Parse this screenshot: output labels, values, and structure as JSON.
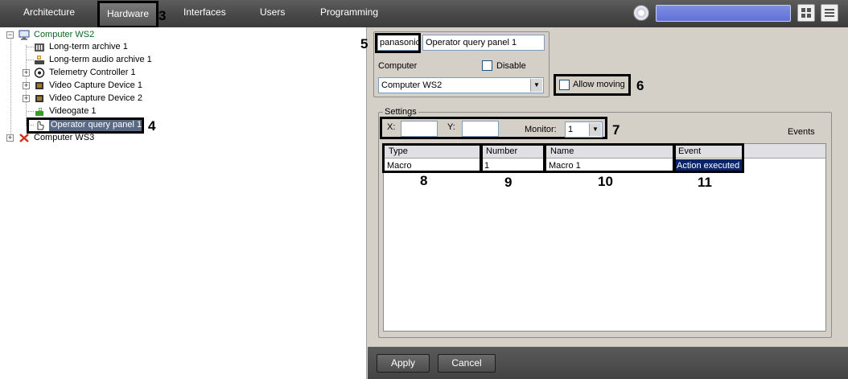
{
  "nav": {
    "tabs": [
      "Architecture",
      "Hardware",
      "Interfaces",
      "Users",
      "Programming"
    ],
    "active_tab": "Hardware",
    "search_value": ""
  },
  "tree": {
    "items": [
      {
        "label": "Computer WS2",
        "icon": "monitor-icon"
      },
      {
        "label": "Long-term archive 1",
        "icon": "archive-icon"
      },
      {
        "label": "Long-term audio archive 1",
        "icon": "audio-archive-icon"
      },
      {
        "label": "Telemetry Controller 1",
        "icon": "telemetry-icon"
      },
      {
        "label": "Video Capture Device 1",
        "icon": "capture-card-icon"
      },
      {
        "label": "Video Capture Device 2",
        "icon": "capture-card-icon"
      },
      {
        "label": "Videogate 1",
        "icon": "videogate-icon"
      },
      {
        "label": "Operator query panel 1",
        "icon": "hand-icon"
      },
      {
        "label": "Computer WS3",
        "icon": "red-x-icon"
      }
    ],
    "selected": "Operator query panel 1"
  },
  "form": {
    "type_value": "panasonic",
    "name_value": "Operator query panel 1",
    "computer_label": "Computer",
    "disable_label": "Disable",
    "computer_value": "Computer WS2",
    "allow_moving_label": "Allow moving",
    "settings_label": "Settings",
    "x_label": "X:",
    "x_value": "",
    "y_label": "Y:",
    "y_value": "",
    "monitor_label": "Monitor:",
    "monitor_value": "1",
    "events_label": "Events"
  },
  "table": {
    "headers": [
      "Type",
      "Number",
      "Name",
      "Event"
    ],
    "rows": [
      [
        "Macro",
        "1",
        "Macro 1",
        "Action executed"
      ]
    ]
  },
  "buttons": {
    "apply": "Apply",
    "cancel": "Cancel"
  },
  "callouts": [
    "3",
    "4",
    "5",
    "6",
    "7",
    "8",
    "9",
    "10",
    "11"
  ],
  "colors": {
    "selection": "#5a6a86",
    "event_cell": "#0a246a",
    "search_fill": "#6b7bd9"
  }
}
